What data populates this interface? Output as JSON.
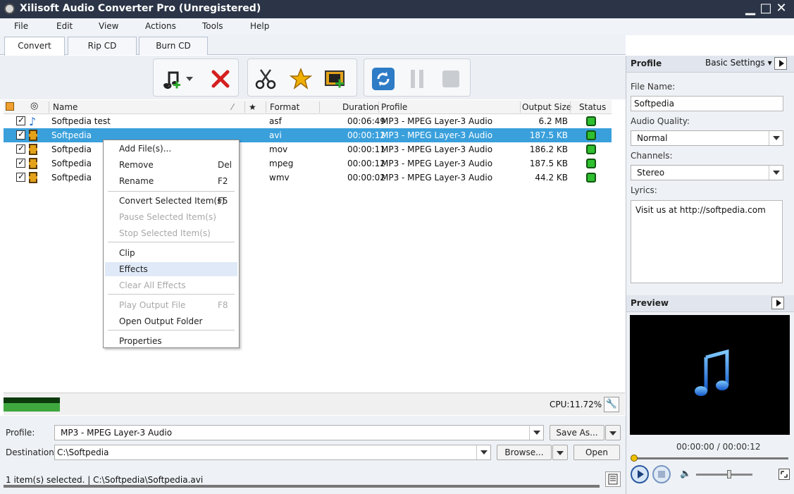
{
  "window": {
    "title": "Xilisoft Audio Converter Pro (Unregistered)",
    "minimize": "▁",
    "maximize": "□",
    "close": "✕"
  },
  "menu": [
    "File",
    "Edit",
    "View",
    "Actions",
    "Tools",
    "Help"
  ],
  "tabs": [
    "Convert",
    "Rip CD",
    "Burn CD"
  ],
  "toolbar": {
    "icons": [
      "add-music-icon",
      "dropdown-arrow-icon",
      "remove-x-icon",
      "scissors-icon",
      "effects-star-icon",
      "add-video-icon",
      "convert-refresh-icon",
      "pause-icon",
      "stop-icon"
    ],
    "colors": {
      "remove": "#d42020",
      "convert": "#2e7bc6",
      "star": "#f0b000"
    }
  },
  "list": {
    "headers": {
      "name": "Name",
      "format": "Format",
      "duration": "Duration",
      "profile": "Profile",
      "output_size": "Output Size",
      "status": "Status",
      "star": "★",
      "sort": "⁄"
    },
    "rows": [
      {
        "name": "Softpedia test",
        "format": "asf",
        "duration": "00:06:49",
        "profile": "MP3 - MPEG Layer-3 Audio",
        "size": "6.2 MB",
        "icon": "audio-note-icon"
      },
      {
        "name": "Softpedia",
        "format": "avi",
        "duration": "00:00:12",
        "profile": "MP3 - MPEG Layer-3 Audio",
        "size": "187.5 KB",
        "icon": "film-icon"
      },
      {
        "name": "Softpedia",
        "format": "mov",
        "duration": "00:00:11",
        "profile": "MP3 - MPEG Layer-3 Audio",
        "size": "186.2 KB",
        "icon": "film-icon"
      },
      {
        "name": "Softpedia",
        "format": "mpeg",
        "duration": "00:00:12",
        "profile": "MP3 - MPEG Layer-3 Audio",
        "size": "187.5 KB",
        "icon": "film-icon"
      },
      {
        "name": "Softpedia",
        "format": "wmv",
        "duration": "00:00:02",
        "profile": "MP3 - MPEG Layer-3 Audio",
        "size": "44.2 KB",
        "icon": "film-icon"
      }
    ],
    "selected_color": "#3aa0dc",
    "status_color": "#2fbf2f"
  },
  "context_menu": [
    {
      "label": "Add File(s)...",
      "key": "",
      "disabled": false
    },
    {
      "label": "Remove",
      "key": "Del",
      "disabled": false
    },
    {
      "label": "Rename",
      "key": "F2",
      "disabled": false
    },
    {
      "label": "Convert Selected Item(s)",
      "key": "F5",
      "disabled": false
    },
    {
      "label": "Pause Selected Item(s)",
      "key": "",
      "disabled": true
    },
    {
      "label": "Stop Selected Item(s)",
      "key": "",
      "disabled": true
    },
    {
      "label": "Clip",
      "key": "",
      "disabled": false
    },
    {
      "label": "Effects",
      "key": "",
      "disabled": false
    },
    {
      "label": "Clear All Effects",
      "key": "",
      "disabled": true
    },
    {
      "label": "Play Output File",
      "key": "F8",
      "disabled": true
    },
    {
      "label": "Open Output Folder",
      "key": "",
      "disabled": false
    },
    {
      "label": "Properties",
      "key": "",
      "disabled": false
    }
  ],
  "cpu": {
    "label": "CPU:11.72%"
  },
  "bottom": {
    "profile_label": "Profile:",
    "profile_value": "MP3 - MPEG Layer-3 Audio",
    "save_as": "Save As...",
    "destination_label": "Destination:",
    "destination_value": "C:\\Softpedia",
    "browse": "Browse...",
    "open": "Open",
    "status": "1 item(s) selected. | C:\\Softpedia\\Softpedia.avi"
  },
  "right_panel": {
    "profile_title": "Profile",
    "basic_settings": "Basic Settings ▾",
    "file_name_label": "File Name:",
    "file_name_value": "Softpedia",
    "audio_quality_label": "Audio Quality:",
    "audio_quality_value": "Normal",
    "channels_label": "Channels:",
    "channels_value": "Stereo",
    "lyrics_label": "Lyrics:",
    "lyrics_value": "Visit us at http://softpedia.com",
    "preview_title": "Preview",
    "time": "00:00:00 / 00:00:12",
    "preview_icon": "music-note-icon",
    "volume_fraction": 0.6
  }
}
